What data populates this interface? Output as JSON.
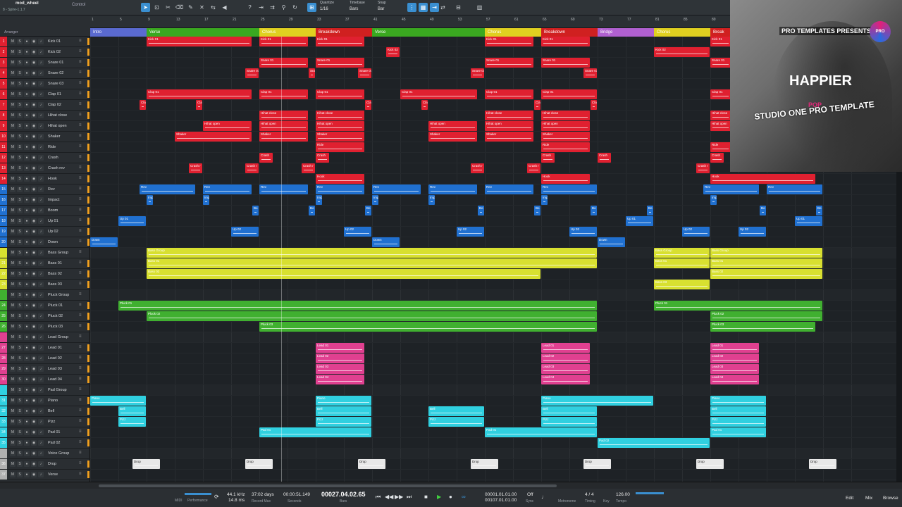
{
  "toolbar": {
    "track_name": "mod_wheel",
    "device": "8 - Spire-1.1.7",
    "control_label": "Control",
    "quantize_label": "Quantize",
    "quantize_value": "1/16",
    "timebase_label": "Timebase",
    "timebase_value": "Bars",
    "snap_label": "Snap",
    "snap_value": "Bar"
  },
  "arranger": {
    "label": "Arranger",
    "ruler_ticks": [
      "1",
      "5",
      "9",
      "13",
      "17",
      "21",
      "25",
      "29",
      "33",
      "37",
      "41",
      "45",
      "49",
      "53",
      "57",
      "61",
      "65",
      "69",
      "73",
      "77",
      "81",
      "85",
      "89"
    ],
    "markers": [
      {
        "label": "Intro",
        "color": "#5a6ad0"
      },
      {
        "label": "Verse",
        "color": "#3aa820"
      },
      {
        "label": "Chorus",
        "color": "#e0d020"
      },
      {
        "label": "Breakdown",
        "color": "#d02020"
      },
      {
        "label": "Verse",
        "color": "#3aa820"
      },
      {
        "label": "Chorus",
        "color": "#e0d020"
      },
      {
        "label": "Breakdown",
        "color": "#d02020"
      },
      {
        "label": "Bridge",
        "color": "#b060d0"
      },
      {
        "label": "Chorus",
        "color": "#e0d020"
      },
      {
        "label": "Break",
        "color": "#d02020"
      }
    ]
  },
  "tracks": [
    {
      "num": "1",
      "name": "Kick 01",
      "color": "#e02030"
    },
    {
      "num": "2",
      "name": "Kick 02",
      "color": "#e02030"
    },
    {
      "num": "3",
      "name": "Snare 01",
      "color": "#e02030"
    },
    {
      "num": "4",
      "name": "Snare 02",
      "color": "#e02030"
    },
    {
      "num": "5",
      "name": "Snare 03",
      "color": "#e02030"
    },
    {
      "num": "6",
      "name": "Clap 01",
      "color": "#e02030"
    },
    {
      "num": "7",
      "name": "Clap 02",
      "color": "#e02030"
    },
    {
      "num": "8",
      "name": "Hihat close",
      "color": "#e02030"
    },
    {
      "num": "9",
      "name": "Hihat open",
      "color": "#e02030"
    },
    {
      "num": "10",
      "name": "Shaker",
      "color": "#e02030"
    },
    {
      "num": "11",
      "name": "Ride",
      "color": "#e02030"
    },
    {
      "num": "12",
      "name": "Crash",
      "color": "#e02030"
    },
    {
      "num": "13",
      "name": "Crash rev",
      "color": "#e02030"
    },
    {
      "num": "14",
      "name": "Hook",
      "color": "#e02030"
    },
    {
      "num": "15",
      "name": "Rev",
      "color": "#2070d0"
    },
    {
      "num": "16",
      "name": "Impact",
      "color": "#2070d0"
    },
    {
      "num": "17",
      "name": "Boom",
      "color": "#2070d0"
    },
    {
      "num": "18",
      "name": "Up 01",
      "color": "#2070d0"
    },
    {
      "num": "19",
      "name": "Up 02",
      "color": "#2070d0"
    },
    {
      "num": "20",
      "name": "Down",
      "color": "#2070d0"
    },
    {
      "num": "",
      "name": "Bass Group",
      "color": "#d8e030"
    },
    {
      "num": "21",
      "name": "Bass 01",
      "color": "#d8e030"
    },
    {
      "num": "22",
      "name": "Bass 02",
      "color": "#d8e030"
    },
    {
      "num": "23",
      "name": "Bass 03",
      "color": "#d8e030"
    },
    {
      "num": "",
      "name": "Pluck Group",
      "color": "#40b030"
    },
    {
      "num": "24",
      "name": "Pluck 01",
      "color": "#40b030"
    },
    {
      "num": "25",
      "name": "Pluck 02",
      "color": "#40b030"
    },
    {
      "num": "26",
      "name": "Pluck 03",
      "color": "#40b030"
    },
    {
      "num": "",
      "name": "Lead Group",
      "color": "#e04090"
    },
    {
      "num": "27",
      "name": "Lead 01",
      "color": "#e04090"
    },
    {
      "num": "28",
      "name": "Lead 02",
      "color": "#e04090"
    },
    {
      "num": "29",
      "name": "Lead 03",
      "color": "#e04090"
    },
    {
      "num": "30",
      "name": "Lead 04",
      "color": "#e04090"
    },
    {
      "num": "",
      "name": "Pad Group",
      "color": "#30d0e0"
    },
    {
      "num": "31",
      "name": "Piano",
      "color": "#30d0e0"
    },
    {
      "num": "32",
      "name": "Bell",
      "color": "#30d0e0"
    },
    {
      "num": "33",
      "name": "Pizz",
      "color": "#30d0e0"
    },
    {
      "num": "34",
      "name": "Pad 01",
      "color": "#30d0e0"
    },
    {
      "num": "35",
      "name": "Pad 02",
      "color": "#30d0e0"
    },
    {
      "num": "",
      "name": "Voice Group",
      "color": "#b0b0b0"
    },
    {
      "num": "36",
      "name": "Drop",
      "color": "#b0b0b0"
    },
    {
      "num": "37",
      "name": "Verse",
      "color": "#b0b0b0"
    }
  ],
  "clips": {
    "kick01": "Kick 01",
    "kick02": "Kick 02",
    "snare01": "Snare 01",
    "clap01": "Clap 01",
    "hihat_close": "Hihat close",
    "hihat_open": "Hihat open",
    "shaker": "Shaker",
    "ride": "Ride",
    "crash": "Crash",
    "crash_rev": "Crash r",
    "hook": "Hook",
    "rev": "Rev",
    "impact": "Imp",
    "boom": "Bo",
    "up01": "Up 01",
    "up02": "Up 02",
    "down": "Down",
    "bass_group": "Bass Group",
    "bass01": "Bass 01",
    "bass02": "Bass 02",
    "bass03": "Bass 03",
    "pluck01": "Pluck 01",
    "pluck02": "Pluck 02",
    "pluck03": "Pluck 03",
    "lead01": "Lead 01",
    "lead02": "Lead 02",
    "lead03": "Lead 03",
    "lead04": "Lead 04",
    "piano": "Piano",
    "bell": "Bell",
    "pizz": "Pizz",
    "pad01": "Pad 01",
    "pad02": "Pad 02",
    "drop": "Drop"
  },
  "overlay": {
    "presents": "PRO TEMPLATES PRESENTS",
    "logo_text": "PRO",
    "title": "HAPPIER",
    "genre": "POP",
    "subtitle": "STUDIO ONE PRO TEMPLATE"
  },
  "transport": {
    "midi_label": "MIDI",
    "performance_label": "Performance",
    "sample_rate": "44.1 kHz",
    "latency": "14.8 ms",
    "record_days": "37:02 days",
    "record_max_label": "Record Max",
    "seconds": "00:00:51.149",
    "seconds_label": "Seconds",
    "bars": "00027.04.02.65",
    "bars_label": "Bars",
    "loop_start": "00001.01.01.00",
    "loop_end": "00107.01.01.00",
    "sync_label": "Off",
    "sync_sub": "Sync",
    "metronome_label": "Metronome",
    "timesig": "4 / 4",
    "timing_label": "Timing",
    "key_label": "Key",
    "tempo": "126.00",
    "tempo_label": "Tempo",
    "edit_label": "Edit",
    "mix_label": "Mix",
    "browse_label": "Browse"
  }
}
